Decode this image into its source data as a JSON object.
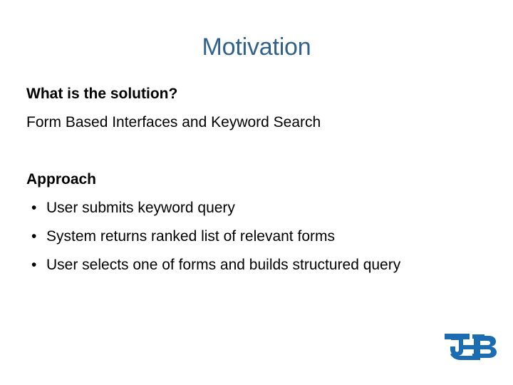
{
  "slide": {
    "title": "Motivation",
    "title_color": "#31628E",
    "background_color": "#FFFFFF",
    "body_color": "#000000"
  },
  "body": {
    "question_heading": "What is the solution?",
    "question_answer": "Form Based Interfaces and Keyword Search",
    "approach_heading": "Approach",
    "bullets": [
      {
        "marker": "•",
        "text": "User submits keyword query"
      },
      {
        "marker": "•",
        "text": "System returns ranked list of relevant forms"
      },
      {
        "marker": "•",
        "text": "User selects one of forms and builds structured query"
      }
    ]
  },
  "logo": {
    "name": "UB",
    "full_name": "UB",
    "color": "#1B6CB0"
  }
}
